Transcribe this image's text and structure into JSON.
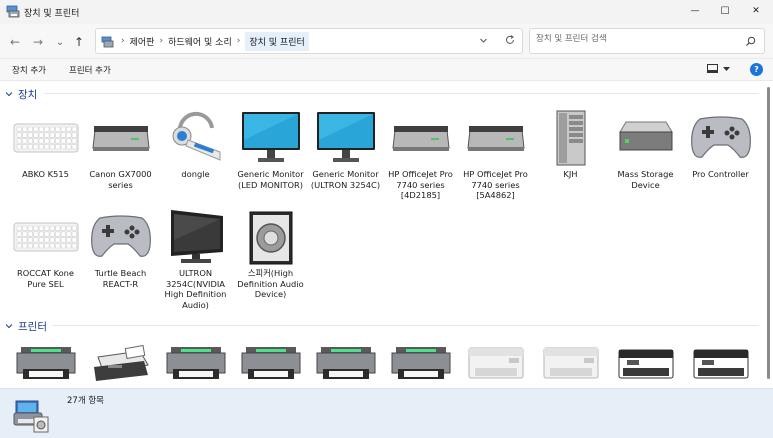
{
  "window": {
    "title": "장치 및 프린터",
    "minimize_glyph": "—",
    "maximize_glyph": "☐",
    "close_glyph": "✕"
  },
  "navigation": {
    "back_glyph": "←",
    "forward_glyph": "→",
    "recent_glyph": "⌄",
    "up_glyph": "↑"
  },
  "breadcrumb": {
    "items": [
      "제어판",
      "하드웨어 및 소리",
      "장치 및 프린터"
    ],
    "separator": "›"
  },
  "search": {
    "placeholder": "장치 및 프린터 검색"
  },
  "toolbar": {
    "add_device": "장치 추가",
    "add_printer": "프린터 추가",
    "help": "?"
  },
  "groups": {
    "devices": {
      "title": "장치",
      "items": [
        {
          "label": "ABKO K515",
          "icon": "keyboard"
        },
        {
          "label": "Canon GX7000 series",
          "icon": "scanner"
        },
        {
          "label": "dongle",
          "icon": "headset"
        },
        {
          "label": "Generic Monitor (LED MONITOR)",
          "icon": "monitor"
        },
        {
          "label": "Generic Monitor (ULTRON 3254C)",
          "icon": "monitor"
        },
        {
          "label": "HP OfficeJet Pro 7740 series [4D2185]",
          "icon": "scanner"
        },
        {
          "label": "HP OfficeJet Pro 7740 series [5A4862]",
          "icon": "scanner"
        },
        {
          "label": "KJH",
          "icon": "computer-tower"
        },
        {
          "label": "Mass Storage Device",
          "icon": "hard-drive"
        },
        {
          "label": "Pro Controller",
          "icon": "gamepad"
        },
        {
          "label": "ROCCAT Kone Pure SEL",
          "icon": "keyboard"
        },
        {
          "label": "Turtle Beach REACT-R",
          "icon": "gamepad"
        },
        {
          "label": "ULTRON 3254C(NVIDIA High Definition Audio)",
          "icon": "tv-display"
        },
        {
          "label": "스피커(High Definition Audio Device)",
          "icon": "speaker"
        }
      ]
    },
    "printers": {
      "title": "프린터",
      "items": [
        {
          "icon": "printer"
        },
        {
          "icon": "fax"
        },
        {
          "icon": "printer"
        },
        {
          "icon": "printer"
        },
        {
          "icon": "printer"
        },
        {
          "icon": "printer"
        },
        {
          "icon": "printer-white"
        },
        {
          "icon": "printer-white"
        },
        {
          "icon": "printer-black"
        },
        {
          "icon": "printer-black"
        }
      ]
    }
  },
  "status": {
    "count_text": "27개 항목"
  },
  "colors": {
    "accent": "#1b74d9",
    "group_header": "#1a3f8a",
    "status_bg": "#e6eef7",
    "monitor_screen": "#29a6d8"
  }
}
